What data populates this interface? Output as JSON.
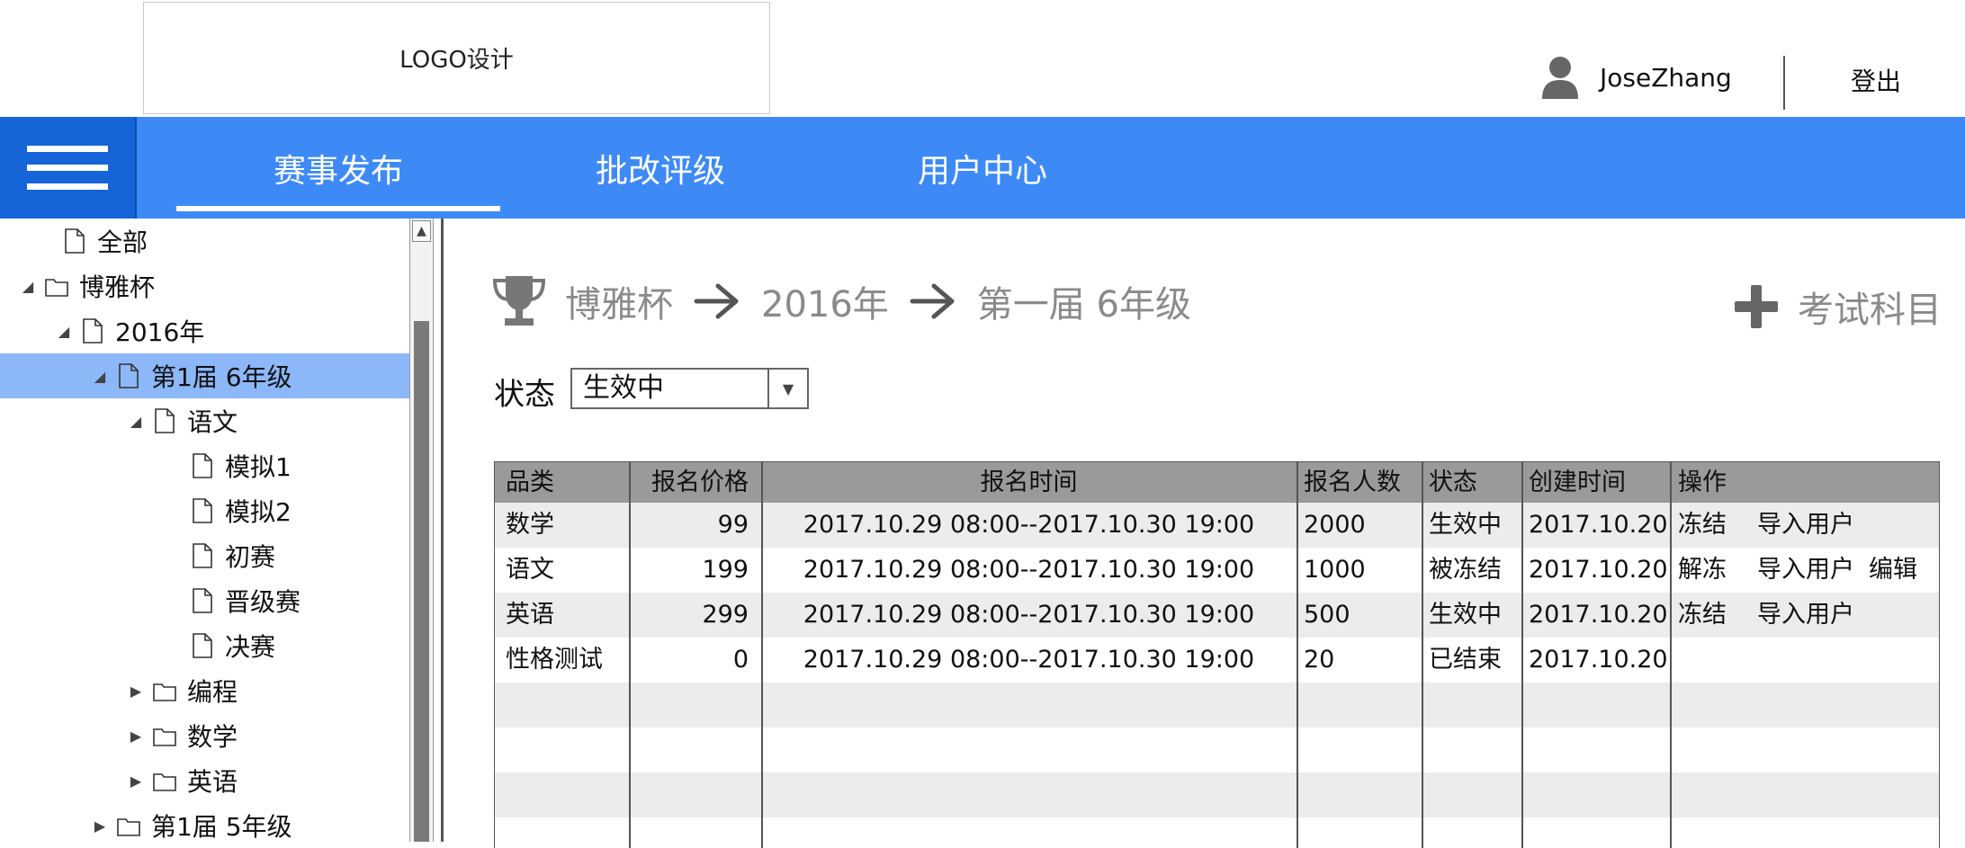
{
  "header": {
    "logo_text": "LOGO设计",
    "user_icon": "user-avatar-icon",
    "username": "JoseZhang",
    "logout_label": "登出"
  },
  "nav": {
    "menu_icon": "hamburger-menu-icon",
    "tabs": [
      {
        "label": "赛事发布",
        "active": true
      },
      {
        "label": "批改评级",
        "active": false
      },
      {
        "label": "用户中心",
        "active": false
      }
    ],
    "bg_color": "#3d8af7",
    "menu_bg_color": "#1565d8"
  },
  "tree": {
    "items": [
      {
        "label": "全部",
        "icon": "file-icon",
        "expander": ""
      },
      {
        "label": "博雅杯",
        "icon": "folder-icon",
        "expander": "expanded"
      },
      {
        "label": "2016年",
        "icon": "file-icon",
        "expander": "expanded"
      },
      {
        "label": "第1届 6年级",
        "icon": "file-icon",
        "expander": "expanded",
        "selected": true
      },
      {
        "label": "语文",
        "icon": "file-icon",
        "expander": "expanded"
      },
      {
        "label": "模拟1",
        "icon": "file-icon",
        "expander": ""
      },
      {
        "label": "模拟2",
        "icon": "file-icon",
        "expander": ""
      },
      {
        "label": "初赛",
        "icon": "file-icon",
        "expander": ""
      },
      {
        "label": "晋级赛",
        "icon": "file-icon",
        "expander": ""
      },
      {
        "label": "决赛",
        "icon": "file-icon",
        "expander": ""
      },
      {
        "label": "编程",
        "icon": "folder-icon",
        "expander": "collapsed"
      },
      {
        "label": "数学",
        "icon": "folder-icon",
        "expander": "collapsed"
      },
      {
        "label": "英语",
        "icon": "folder-icon",
        "expander": "collapsed"
      },
      {
        "label": "第1届 5年级",
        "icon": "folder-icon",
        "expander": "collapsed"
      }
    ],
    "selected_color": "#8cb8fa"
  },
  "breadcrumb": {
    "icon": "trophy-icon",
    "items": [
      "博雅杯",
      "2016年",
      "第一届 6年级"
    ]
  },
  "add_subject": {
    "icon": "plus-icon",
    "label": "考试科目"
  },
  "filter": {
    "status_label": "状态",
    "status_value": "生效中"
  },
  "table": {
    "headers": [
      "品类",
      "报名价格",
      "报名时间",
      "报名人数",
      "状态",
      "创建时间",
      "操作"
    ],
    "rows": [
      {
        "category": "数学",
        "price": "99",
        "time": "2017.10.29 08:00--2017.10.30 19:00",
        "count": "2000",
        "status": "生效中",
        "created": "2017.10.20",
        "actions": [
          "冻结",
          "导入用户"
        ]
      },
      {
        "category": "语文",
        "price": "199",
        "time": "2017.10.29 08:00--2017.10.30 19:00",
        "count": "1000",
        "status": "被冻结",
        "created": "2017.10.20",
        "actions": [
          "解冻",
          "导入用户",
          "编辑"
        ]
      },
      {
        "category": "英语",
        "price": "299",
        "time": "2017.10.29 08:00--2017.10.30 19:00",
        "count": "500",
        "status": "生效中",
        "created": "2017.10.20",
        "actions": [
          "冻结",
          "导入用户"
        ]
      },
      {
        "category": "性格测试",
        "price": "0",
        "time": "2017.10.29 08:00--2017.10.30 19:00",
        "count": "20",
        "status": "已结束",
        "created": "2017.10.20",
        "actions": []
      }
    ],
    "header_bg": "#9a9a9a",
    "stripe_bg": "#ececec"
  }
}
